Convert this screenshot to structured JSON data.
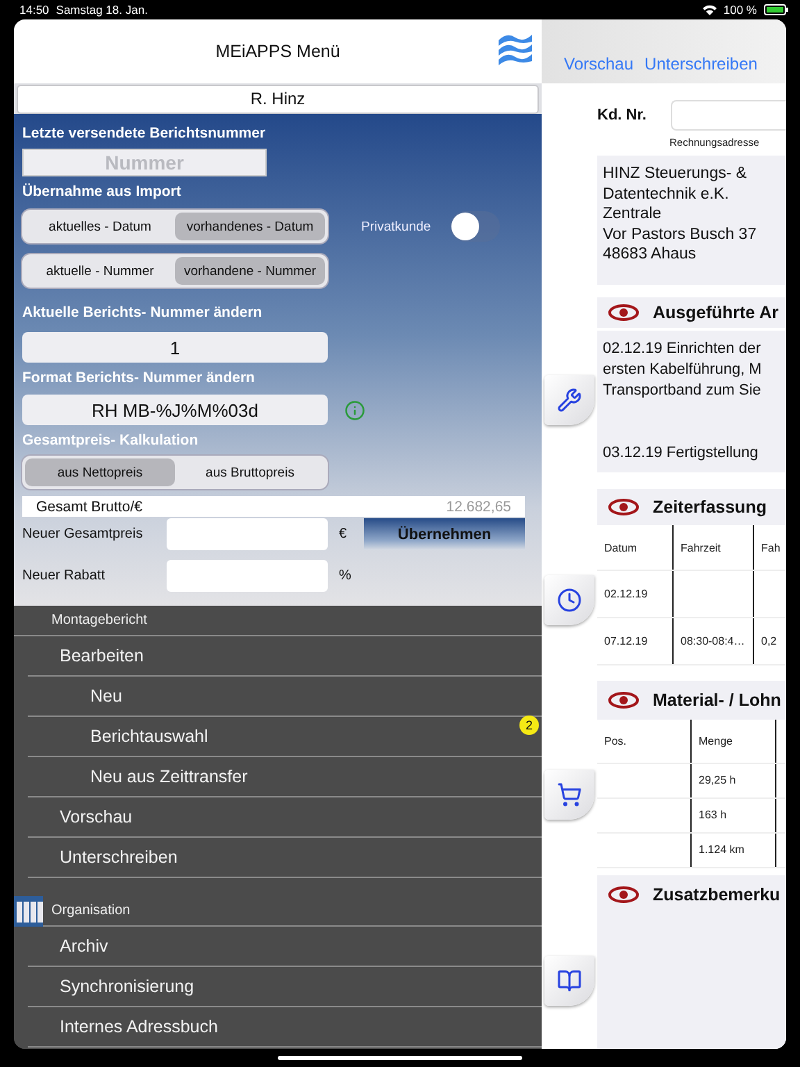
{
  "status_bar": {
    "time": "14:50",
    "date": "Samstag 18. Jan.",
    "battery": "100 %"
  },
  "menu_panel": {
    "title": "MEiAPPS Menü",
    "user": "R. Hinz"
  },
  "form": {
    "last_number": {
      "label": "Letzte versendete Berichtsnummer",
      "placeholder": "Nummer"
    },
    "import": {
      "label": "Übernahme aus Import",
      "groups": [
        {
          "options": [
            {
              "label": "aktuelles - Datum",
              "selected": false
            },
            {
              "label": "vorhandenes - Datum",
              "selected": true
            }
          ]
        },
        {
          "options": [
            {
              "label": "aktuelle - Nummer",
              "selected": false
            },
            {
              "label": "vorhandene - Nummer",
              "selected": true
            }
          ]
        }
      ]
    },
    "private_customer": {
      "label": "Privatkunde",
      "on": false
    },
    "current_number": {
      "label": "Aktuelle Berichts- Nummer ändern",
      "value": "1"
    },
    "number_format": {
      "label": "Format Berichts- Nummer ändern",
      "value": "RH MB-%J%M%03d"
    },
    "calculation": {
      "label": "Gesamtpreis- Kalkulation",
      "options": [
        {
          "label": "aus Nettopreis",
          "selected": true
        },
        {
          "label": "aus Bruttopreis",
          "selected": false
        }
      ]
    },
    "total": {
      "label": "Gesamt Brutto/€",
      "value": "12.682,65"
    },
    "new_total": {
      "label": "Neuer Gesamtpreis",
      "unit": "€",
      "button": "Übernehmen"
    },
    "new_discount": {
      "label": "Neuer Rabatt",
      "unit": "%"
    }
  },
  "menu": [
    {
      "title": "Montagebericht",
      "icon": false,
      "items": [
        {
          "label": "Bearbeiten",
          "children": [
            {
              "label": "Neu"
            },
            {
              "label": "Berichtauswahl",
              "badge": "2"
            },
            {
              "label": "Neu aus Zeittransfer"
            }
          ]
        },
        {
          "label": "Vorschau"
        },
        {
          "label": "Unterschreiben"
        }
      ]
    },
    {
      "title": "Organisation",
      "icon": true,
      "items": [
        {
          "label": "Archiv"
        },
        {
          "label": "Synchronisierung"
        },
        {
          "label": "Internes Adressbuch"
        }
      ]
    }
  ],
  "report": {
    "links": [
      "Vorschau",
      "Unterschreiben"
    ],
    "customer_label": "Kd. Nr.",
    "address_label": "Rechnungsadresse",
    "address": [
      "HINZ Steuerungs- &",
      "Datentechnik e.K.",
      "Zentrale",
      "Vor Pastors Busch 37",
      "48683 Ahaus"
    ],
    "sections": [
      {
        "kind": "text",
        "title": "Ausgeführte Ar",
        "paragraphs": [
          [
            "02.12.19 Einrichten der",
            "ersten Kabelführung, M",
            "Transportband zum Sie"
          ],
          [
            "03.12.19 Fertigstellung"
          ]
        ]
      },
      {
        "kind": "table",
        "title": "Zeiterfassung",
        "columns": [
          "Datum",
          "Fahrzeit",
          "Fah"
        ],
        "rows": [
          [
            "02.12.19",
            null,
            null
          ],
          [
            "07.12.19",
            "08:30-08:4…",
            "0,2"
          ]
        ]
      },
      {
        "kind": "table",
        "title": "Material- / Lohn",
        "columns": [
          "Pos.",
          "Menge",
          null
        ],
        "rows": [
          [
            null,
            "29,25 h",
            null
          ],
          [
            null,
            "163 h",
            null
          ],
          [
            null,
            "1.124 km",
            null
          ]
        ]
      },
      {
        "kind": "notes",
        "title": "Zusatzbemerku"
      }
    ]
  }
}
